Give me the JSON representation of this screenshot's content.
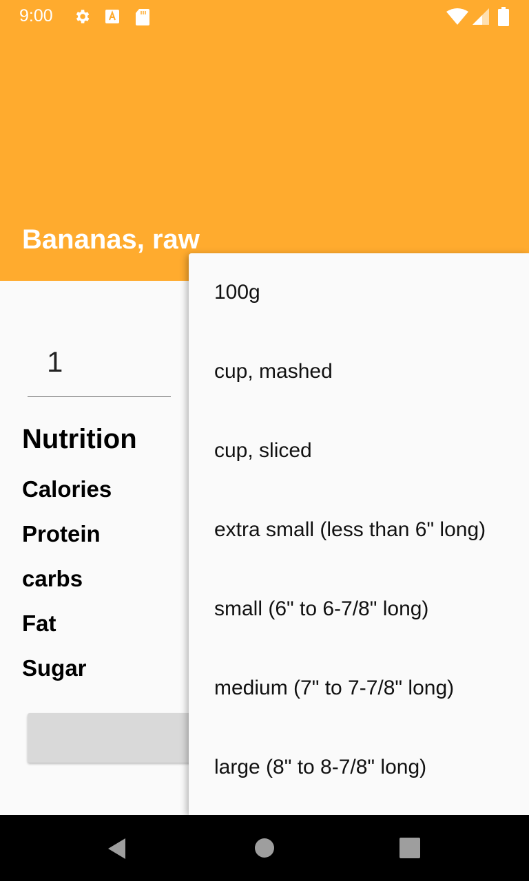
{
  "status_bar": {
    "time": "9:00",
    "icons": [
      "gear-icon",
      "text-a-icon",
      "sd-card-icon",
      "wifi-icon",
      "signal-icon",
      "battery-icon"
    ]
  },
  "app_bar": {
    "title": "Bananas, raw",
    "color": "#ffab2e"
  },
  "form": {
    "quantity": "1"
  },
  "nutrition": {
    "title": "Nutrition",
    "labels": [
      "Calories",
      "Protein",
      "carbs",
      "Fat",
      "Sugar"
    ]
  },
  "dropdown": {
    "options": [
      "100g",
      "cup, mashed",
      "cup, sliced",
      "extra small (less than 6\" long)",
      "small (6\" to 6-7/8\" long)",
      "medium (7\" to 7-7/8\" long)",
      "large (8\" to 8-7/8\" long)"
    ]
  },
  "nav_bar": {
    "icons": [
      "back-icon",
      "home-icon",
      "recents-icon"
    ]
  }
}
